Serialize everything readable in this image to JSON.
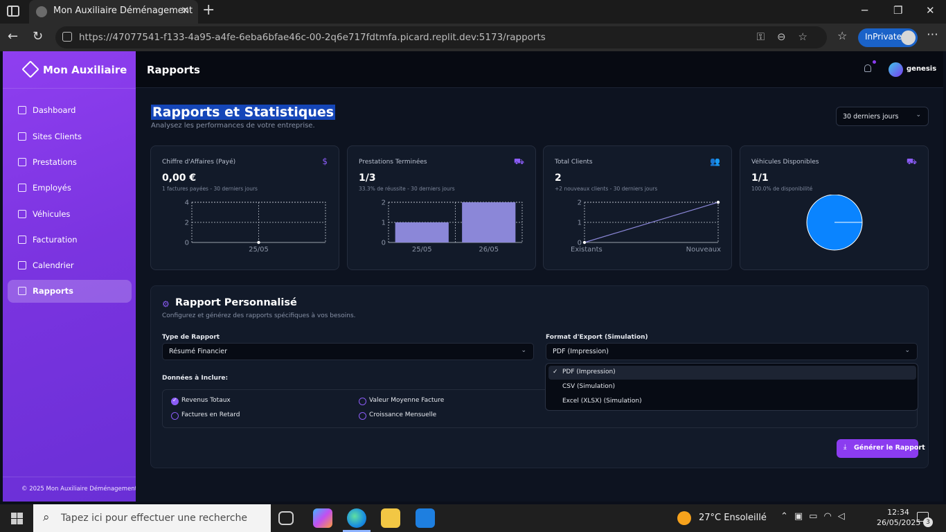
{
  "browser": {
    "tab_title": "Mon Auxiliaire Déménagement",
    "url": "https://47077541-f133-4a95-a4fe-6eba6bfae46c-00-2q6e717fdtmfa.picard.replit.dev:5173/rapports",
    "inprivate_label": "InPrivate"
  },
  "sidebar": {
    "brand": "Mon Auxiliaire",
    "items": [
      {
        "label": "Dashboard",
        "icon": "grid-icon"
      },
      {
        "label": "Sites Clients",
        "icon": "building-icon"
      },
      {
        "label": "Prestations",
        "icon": "truck-icon"
      },
      {
        "label": "Employés",
        "icon": "users-icon"
      },
      {
        "label": "Véhicules",
        "icon": "truck-icon"
      },
      {
        "label": "Facturation",
        "icon": "file-icon"
      },
      {
        "label": "Calendrier",
        "icon": "calendar-icon"
      },
      {
        "label": "Rapports",
        "icon": "bar-chart-icon",
        "active": true
      }
    ],
    "footer": "© 2025 Mon Auxiliaire Déménagement"
  },
  "header": {
    "title": "Rapports",
    "user": "genesis"
  },
  "main": {
    "title": "Rapports et Statistiques",
    "subtitle": "Analysez les performances de votre entreprise.",
    "period": "30 derniers jours"
  },
  "cards": [
    {
      "title": "Chiffre d'Affaires (Payé)",
      "value": "0,00 €",
      "sub": "1 factures payées - 30 derniers jours",
      "icon": "dollar-icon"
    },
    {
      "title": "Prestations Terminées",
      "value": "1/3",
      "sub": "33.3% de réussite - 30 derniers jours",
      "icon": "truck-icon"
    },
    {
      "title": "Total Clients",
      "value": "2",
      "sub": "+2 nouveaux clients - 30 derniers jours",
      "icon": "users-icon"
    },
    {
      "title": "Véhicules Disponibles",
      "value": "1/1",
      "sub": "100.0% de disponibilité",
      "icon": "truck-icon"
    }
  ],
  "chart_data": [
    {
      "type": "line",
      "x": [
        "25/05"
      ],
      "y": [
        0
      ],
      "yticks": [
        "0",
        "2",
        "4"
      ],
      "ylim": [
        0,
        4
      ],
      "xlabel": "",
      "ylabel": ""
    },
    {
      "type": "bar",
      "categories": [
        "25/05",
        "26/05"
      ],
      "values": [
        1,
        2
      ],
      "yticks": [
        "0",
        "1",
        "2"
      ],
      "ylim": [
        0,
        2
      ],
      "xlabel": "",
      "ylabel": ""
    },
    {
      "type": "line",
      "x": [
        "Existants",
        "Nouveaux"
      ],
      "y": [
        0,
        2
      ],
      "yticks": [
        "0",
        "1",
        "2"
      ],
      "ylim": [
        0,
        2
      ],
      "xlabel": "",
      "ylabel": ""
    },
    {
      "type": "pie",
      "values": [
        1
      ],
      "colors": [
        "#0a84ff"
      ]
    }
  ],
  "report": {
    "title": "Rapport Personnalisé",
    "subtitle": "Configurez et générez des rapports spécifiques à vos besoins.",
    "type_label": "Type de Rapport",
    "type_value": "Résumé Financier",
    "format_label": "Format d'Export (Simulation)",
    "format_value": "PDF (Impression)",
    "format_options": [
      "PDF (Impression)",
      "CSV (Simulation)",
      "Excel (XLSX) (Simulation)"
    ],
    "data_label": "Données à Inclure:",
    "checks": [
      {
        "label": "Revenus Totaux",
        "checked": true
      },
      {
        "label": "Valeur Moyenne Facture",
        "checked": false
      },
      {
        "label": "Factures en Retard",
        "checked": false
      },
      {
        "label": "Croissance Mensuelle",
        "checked": false
      }
    ],
    "generate_label": "Générer le Rapport"
  },
  "taskbar": {
    "search_placeholder": "Tapez ici pour effectuer une recherche",
    "weather": "27°C  Ensoleillé",
    "time": "12:34",
    "date": "26/05/2025",
    "notifications": "3"
  },
  "colors": {
    "accent": "#8b3cf0",
    "bar": "#8b87d8",
    "pie": "#0a84ff",
    "highlight": "#1546b8"
  }
}
